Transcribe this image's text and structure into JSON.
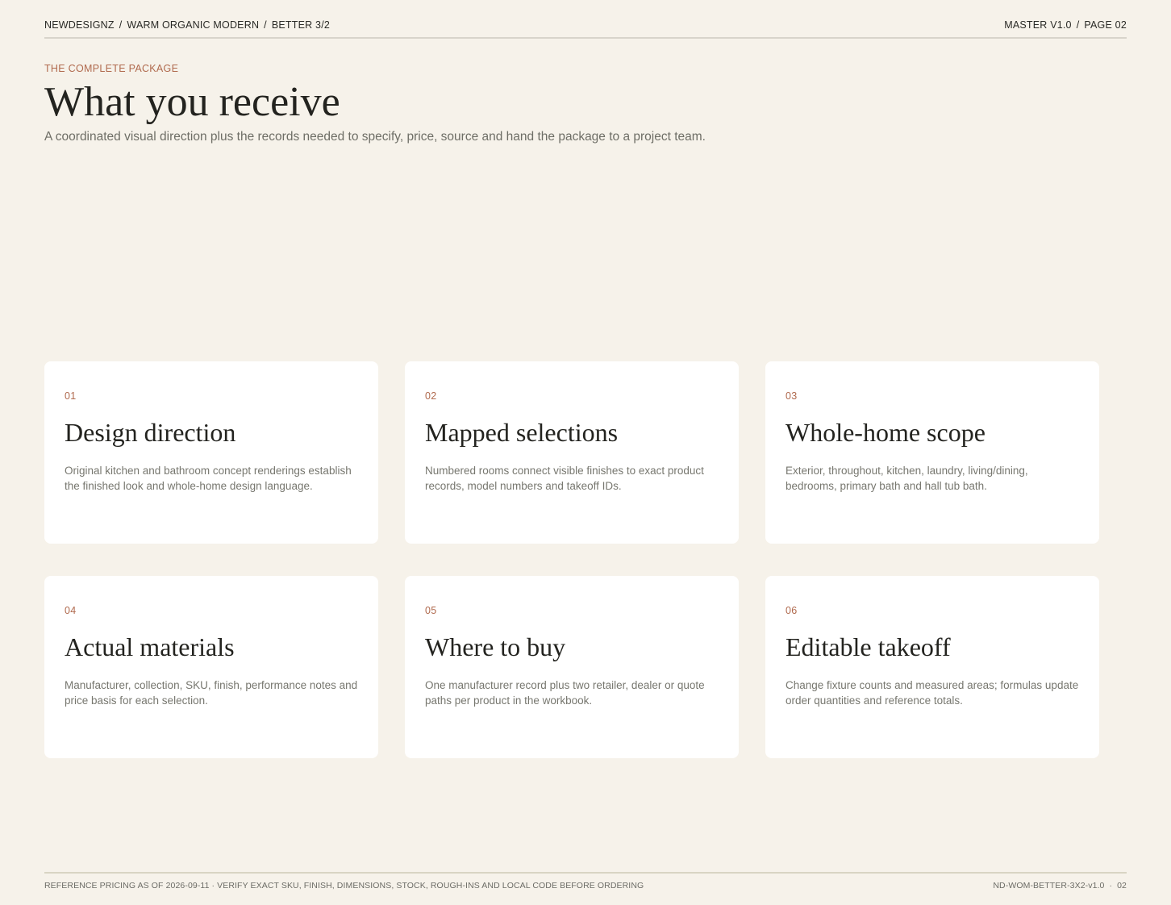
{
  "header": {
    "breadcrumb": [
      "NEWDESIGNZ",
      "WARM ORGANIC MODERN",
      "BETTER 3/2"
    ],
    "version": "MASTER V1.0",
    "page": "PAGE 02"
  },
  "intro": {
    "eyebrow": "THE COMPLETE PACKAGE",
    "title": "What you receive",
    "subtitle": "A coordinated visual direction plus the records needed to specify, price, source and hand the package to a project team."
  },
  "cards": [
    {
      "num": "01",
      "title": "Design direction",
      "desc": "Original kitchen and bathroom concept renderings establish the finished look and whole-home design language."
    },
    {
      "num": "02",
      "title": "Mapped selections",
      "desc": "Numbered rooms connect visible finishes to exact product records, model numbers and takeoff IDs."
    },
    {
      "num": "03",
      "title": "Whole-home scope",
      "desc": "Exterior, throughout, kitchen, laundry, living/dining, bedrooms, primary bath and hall tub bath."
    },
    {
      "num": "04",
      "title": "Actual materials",
      "desc": "Manufacturer, collection, SKU, finish, performance notes and price basis for each selection."
    },
    {
      "num": "05",
      "title": "Where to buy",
      "desc": "One manufacturer record plus two retailer, dealer or quote paths per product in the workbook."
    },
    {
      "num": "06",
      "title": "Editable takeoff",
      "desc": "Change fixture counts and measured areas; formulas update order quantities and reference totals."
    }
  ],
  "footer": {
    "disclaimer": "REFERENCE PRICING AS OF 2026-09-11 · VERIFY EXACT SKU, FINISH, DIMENSIONS, STOCK, ROUGH-INS AND LOCAL CODE BEFORE ORDERING",
    "doc_id": "ND-WOM-BETTER-3X2-v1.0",
    "separator": "·",
    "page_num": "02"
  }
}
